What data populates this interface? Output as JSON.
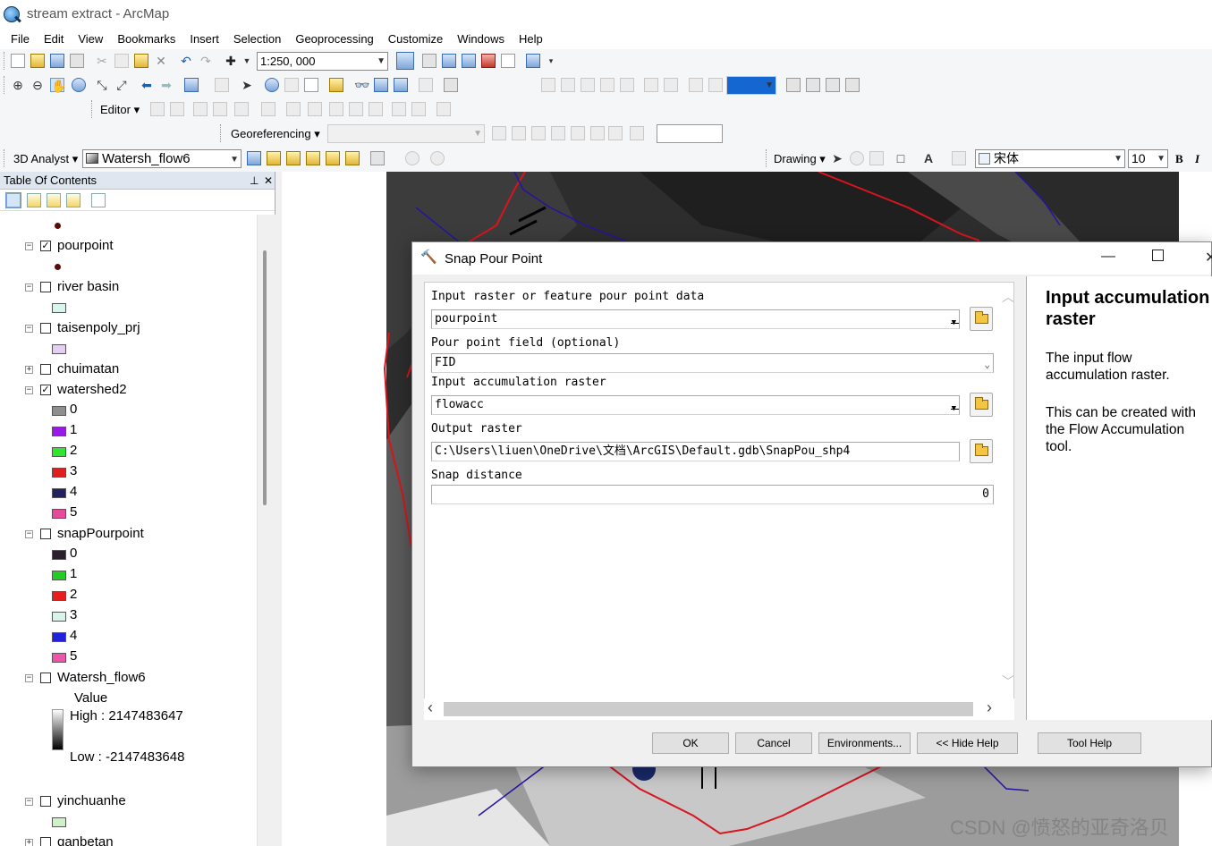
{
  "app": {
    "title": "stream extract - ArcMap"
  },
  "menu": [
    "File",
    "Edit",
    "View",
    "Bookmarks",
    "Insert",
    "Selection",
    "Geoprocessing",
    "Customize",
    "Windows",
    "Help"
  ],
  "toolbar": {
    "scale": "1:250, 000",
    "editor_label": "Editor",
    "georeferencing_label": "Georeferencing",
    "analyst_label": "3D Analyst",
    "analyst_layer": "Watersh_flow6",
    "drawing_label": "Drawing",
    "font_name": "宋体",
    "font_size": "10",
    "bold": "B",
    "italic": "I"
  },
  "toc": {
    "title": "Table Of Contents",
    "pin": "⊥",
    "close": "✕",
    "layers": [
      {
        "name": "pourpoint",
        "checked": true
      },
      {
        "name": "river basin",
        "checked": false
      },
      {
        "name": "taisenpoly_prj",
        "checked": false
      },
      {
        "name": "chuimatan",
        "checked": false
      },
      {
        "name": "watershed2",
        "checked": true,
        "classes": [
          "0",
          "1",
          "2",
          "3",
          "4",
          "5"
        ]
      },
      {
        "name": "snapPourpoint",
        "checked": false,
        "classes": [
          "0",
          "1",
          "2",
          "3",
          "4",
          "5"
        ]
      },
      {
        "name": "Watersh_flow6",
        "checked": false,
        "value_label": "Value",
        "high": "High : 2147483647",
        "low": "Low : -2147483648"
      },
      {
        "name": "yinchuanhe",
        "checked": false
      },
      {
        "name": "qanbetan",
        "checked": false
      }
    ],
    "colors": {
      "river_basin": "#d8f4ec",
      "taisenpoly": "#e3cff0",
      "yinchuanhe": "#cff0c8",
      "watershed2": [
        "#8e8e8e",
        "#9b19e6",
        "#2ee62e",
        "#dd1f1f",
        "#22225e",
        "#e64a9a"
      ],
      "snapPourpoint": [
        "#2a1f2a",
        "#22cc22",
        "#e61e1e",
        "#d8f4ec",
        "#2222dd",
        "#ee55aa"
      ]
    }
  },
  "dialog": {
    "title": "Snap Pour Point",
    "fields": {
      "input_pour_point": {
        "label": "Input raster or feature pour point data",
        "value": "pourpoint"
      },
      "pour_point_field": {
        "label": "Pour point field (optional)",
        "value": "FID"
      },
      "input_accumulation": {
        "label": "Input accumulation raster",
        "value": "flowacc"
      },
      "output_raster": {
        "label": "Output raster",
        "value": "C:\\Users\\liuen\\OneDrive\\文档\\ArcGIS\\Default.gdb\\SnapPou_shp4"
      },
      "snap_distance": {
        "label": "Snap distance",
        "value": "0"
      }
    },
    "help": {
      "title": "Input accumulation raster",
      "p1": "The input flow accumulation raster.",
      "p2": "This can be created with the Flow Accumulation tool."
    },
    "buttons": {
      "ok": "OK",
      "cancel": "Cancel",
      "environments": "Environments...",
      "hide_help": "<< Hide Help",
      "tool_help": "Tool Help"
    }
  },
  "watermark": "CSDN @愤怒的亚奇洛贝"
}
